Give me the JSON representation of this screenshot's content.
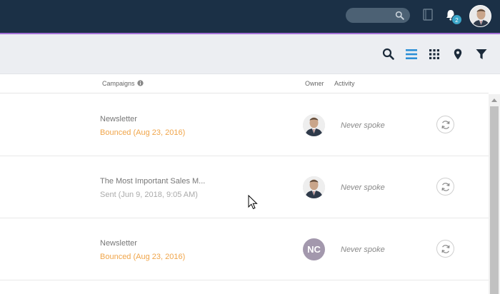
{
  "topbar": {
    "search_placeholder": "",
    "notifications_count": "2",
    "icons": [
      "search-icon",
      "book-icon",
      "bell-icon",
      "user-avatar"
    ]
  },
  "toolbar": {
    "icons": [
      "search-icon",
      "list-view-icon",
      "grid-view-icon",
      "map-pin-icon",
      "filter-icon"
    ],
    "active_view": "list-view"
  },
  "columns": {
    "campaigns": "Campaigns",
    "owner": "Owner",
    "activity": "Activity"
  },
  "rows": [
    {
      "campaign_name": "Newsletter",
      "campaign_status": "Bounced (Aug 23, 2016)",
      "status_type": "bounced",
      "owner_type": "photo",
      "owner_initials": "",
      "activity": "Never spoke"
    },
    {
      "campaign_name": "The Most Important Sales M...",
      "campaign_status": "Sent (Jun 9, 2018, 9:05 AM)",
      "status_type": "sent",
      "owner_type": "photo",
      "owner_initials": "",
      "activity": "Never spoke"
    },
    {
      "campaign_name": "Newsletter",
      "campaign_status": "Bounced (Aug 23, 2016)",
      "status_type": "bounced",
      "owner_type": "initials",
      "owner_initials": "NC",
      "activity": "Never spoke"
    }
  ],
  "colors": {
    "topbar": "#1b3046",
    "accent": "#a36fd6",
    "bounced": "#f0a54a",
    "sent": "#aaaaaa",
    "badge": "#3ba6c9",
    "active_icon": "#2c8fd6"
  }
}
